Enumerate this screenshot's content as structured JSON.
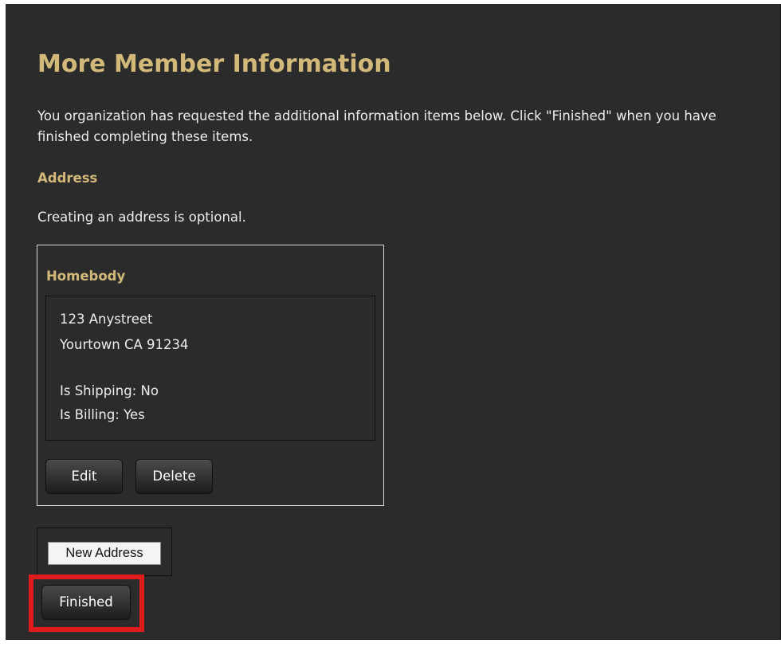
{
  "page": {
    "title": "More Member Information",
    "intro": "You organization has requested the additional information items below. Click \"Finished\" when you have finished completing these items."
  },
  "address_section": {
    "heading": "Address",
    "note": "Creating an address is optional.",
    "addresses": [
      {
        "name": "Homebody",
        "street": "123 Anystreet",
        "city_line": "Yourtown CA 91234",
        "shipping": "Is Shipping: No",
        "billing": "Is Billing: Yes",
        "edit_label": "Edit",
        "delete_label": "Delete"
      }
    ],
    "new_address_label": "New Address"
  },
  "actions": {
    "finished_label": "Finished"
  },
  "colors": {
    "background": "#2b2b2b",
    "heading_gold": "#d2b97a",
    "text": "#ededed",
    "highlight": "#e01b1b"
  }
}
